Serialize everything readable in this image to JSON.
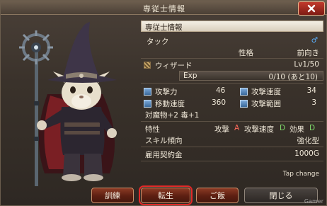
{
  "window": {
    "title": "専従士情報"
  },
  "header": {
    "label": "専従士情報"
  },
  "character": {
    "name": "タック",
    "gender_symbol": "♂",
    "personality_label": "性格",
    "personality_value": "前向き",
    "class_name": "ウィザード",
    "level": "Lv1/50",
    "exp_label": "Exp",
    "exp_value": "0/10 (あと10)"
  },
  "stats": [
    {
      "label": "攻撃力",
      "value": "46",
      "icon": "sword-icon"
    },
    {
      "label": "攻撃速度",
      "value": "34",
      "icon": "speed-icon"
    },
    {
      "label": "移動速度",
      "value": "360",
      "icon": "boot-icon"
    },
    {
      "label": "攻撃範囲",
      "value": "3",
      "icon": "range-icon"
    }
  ],
  "bonus": "対魔物+2 毒+1",
  "traits": {
    "label": "特性",
    "attack_label": "攻撃",
    "attack_grade": "A",
    "speed_label": "攻撃速度",
    "speed_grade": "D",
    "effect_label": "効果",
    "effect_grade": "D"
  },
  "skill": {
    "label": "スキル傾向",
    "value": "強化型"
  },
  "contract": {
    "label": "雇用契約金",
    "value": "1000G"
  },
  "tap_change": "Tap change",
  "buttons": {
    "train": "訓練",
    "reincarnate": "転生",
    "meal": "ご飯",
    "close": "閉じる"
  },
  "watermark": "Gamer",
  "colors": {
    "accent": "#e02828",
    "button": "#6a2a18",
    "grade_a": "#ff6a5a",
    "grade_d": "#7ed86a"
  }
}
